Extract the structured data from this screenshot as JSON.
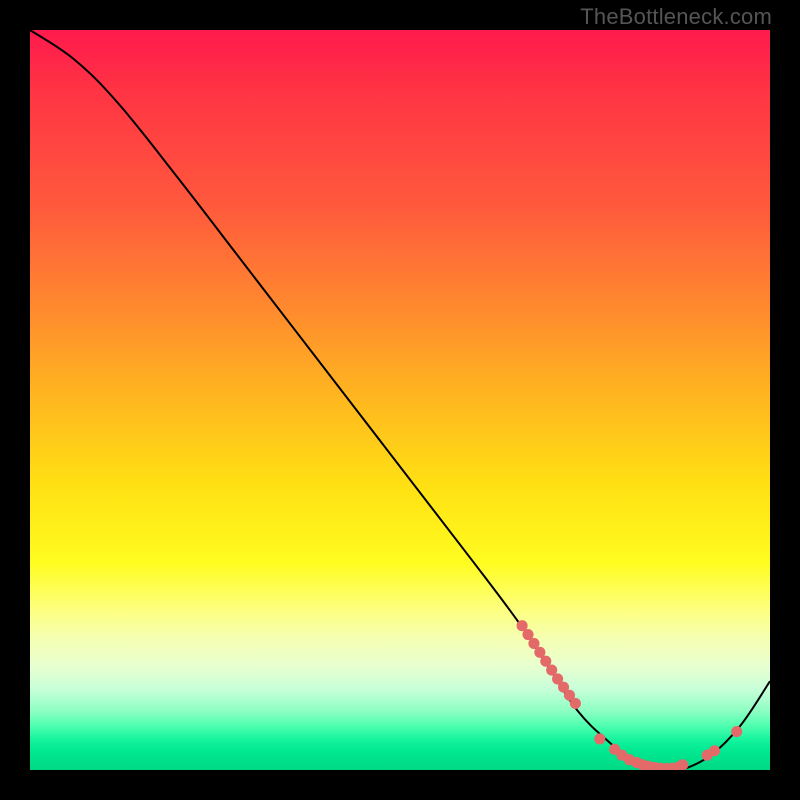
{
  "watermark": "TheBottleneck.com",
  "chart_data": {
    "type": "line",
    "title": "",
    "xlabel": "",
    "ylabel": "",
    "xlim": [
      0,
      100
    ],
    "ylim": [
      0,
      100
    ],
    "grid": false,
    "legend": false,
    "series": [
      {
        "name": "curve",
        "x": [
          0,
          6,
          12,
          20,
          30,
          40,
          50,
          60,
          66,
          70,
          74,
          78,
          82,
          86,
          88,
          92,
          96,
          100
        ],
        "y": [
          100,
          96,
          90,
          80,
          67,
          54,
          41,
          28,
          20,
          14,
          8,
          4,
          1,
          0,
          0,
          2,
          6,
          12
        ]
      }
    ],
    "markers": [
      {
        "name": "cluster-descent",
        "x": [
          66.5,
          67.3,
          68.1,
          68.9,
          69.7,
          70.5,
          71.3,
          72.1,
          72.9,
          73.7
        ],
        "y": [
          19.5,
          18.3,
          17.1,
          15.9,
          14.7,
          13.5,
          12.3,
          11.2,
          10.1,
          9.0
        ]
      },
      {
        "name": "cluster-valley",
        "x": [
          77,
          79,
          80,
          81,
          82,
          82.8,
          83.6,
          84.4,
          85.2,
          86,
          86.8,
          87.6,
          88.2
        ],
        "y": [
          4.2,
          2.8,
          2.0,
          1.4,
          1.0,
          0.7,
          0.5,
          0.35,
          0.25,
          0.2,
          0.25,
          0.4,
          0.7
        ]
      },
      {
        "name": "cluster-ascent",
        "x": [
          91.5,
          92.5,
          95.5
        ],
        "y": [
          2.0,
          2.6,
          5.2
        ]
      }
    ],
    "colors": {
      "curve": "#000000",
      "marker": "#e46a6a",
      "bg_top": "#ff1a4d",
      "bg_bottom": "#00d884"
    }
  }
}
